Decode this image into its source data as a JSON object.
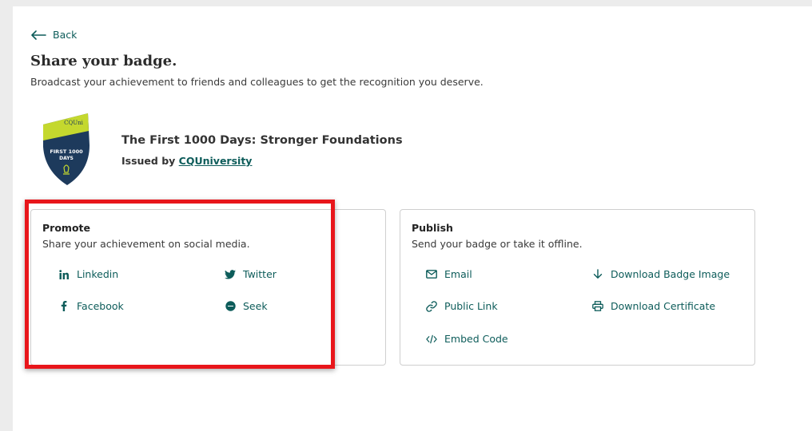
{
  "back": {
    "label": "Back"
  },
  "header": {
    "title": "Share your badge.",
    "subtitle": "Broadcast your achievement to friends and colleagues to get the recognition you deserve."
  },
  "badge": {
    "name": "The First 1000 Days: Stronger Foundations",
    "issued_prefix": "Issued by",
    "issuer": "CQUniversity",
    "image_text_top": "CQUni",
    "image_text_main": "FIRST 1000",
    "image_text_sub": "DAYS",
    "colors": {
      "lime": "#c4d82e",
      "navy": "#1d3a5c"
    }
  },
  "promote": {
    "title": "Promote",
    "description": "Share your achievement on social media.",
    "actions": [
      {
        "label": "Linkedin",
        "icon": "linkedin-icon"
      },
      {
        "label": "Twitter",
        "icon": "twitter-icon"
      },
      {
        "label": "Facebook",
        "icon": "facebook-icon"
      },
      {
        "label": "Seek",
        "icon": "seek-icon"
      }
    ]
  },
  "publish": {
    "title": "Publish",
    "description": "Send your badge or take it offline.",
    "actions": [
      {
        "label": "Email",
        "icon": "email-icon"
      },
      {
        "label": "Download Badge Image",
        "icon": "download-icon"
      },
      {
        "label": "Public Link",
        "icon": "link-icon"
      },
      {
        "label": "Download Certificate",
        "icon": "print-icon"
      },
      {
        "label": "Embed Code",
        "icon": "code-icon"
      }
    ]
  },
  "colors": {
    "accent": "#0d5c5a",
    "highlight": "#e8161b"
  }
}
